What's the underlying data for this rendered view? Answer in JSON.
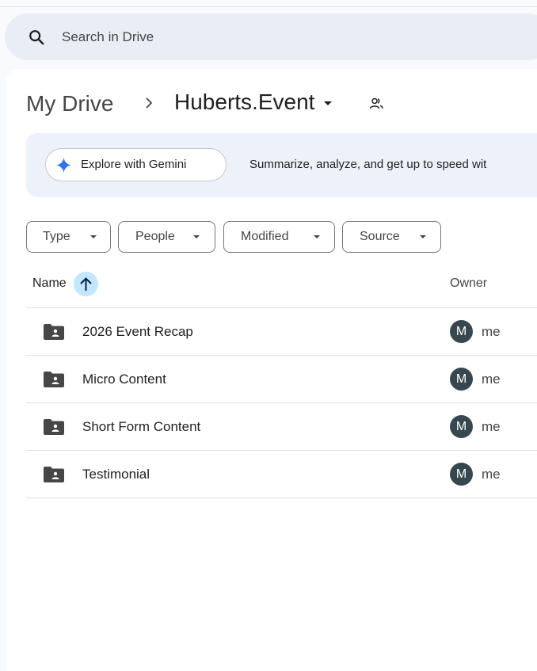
{
  "search": {
    "placeholder": "Search in Drive"
  },
  "breadcrumb": {
    "root": "My Drive",
    "separator": "›",
    "current": "Huberts.Event"
  },
  "gemini": {
    "button_label": "Explore with Gemini",
    "description": "Summarize, analyze, and get up to speed wit"
  },
  "filters": [
    {
      "label": "Type"
    },
    {
      "label": "People"
    },
    {
      "label": "Modified"
    },
    {
      "label": "Source"
    }
  ],
  "columns": {
    "name": "Name",
    "owner": "Owner"
  },
  "rows": [
    {
      "name": "2026 Event Recap",
      "owner_initial": "M",
      "owner": "me"
    },
    {
      "name": "Micro Content",
      "owner_initial": "M",
      "owner": "me"
    },
    {
      "name": "Short Form Content",
      "owner_initial": "M",
      "owner": "me"
    },
    {
      "name": "Testimonial",
      "owner_initial": "M",
      "owner": "me"
    }
  ],
  "colors": {
    "accent_sort": "#c2e7ff",
    "gemini_blue": "#4285f4",
    "avatar": "#37474f"
  },
  "icons": [
    "search-icon",
    "chevron-right-icon",
    "caret-down-icon",
    "shared-people-icon",
    "gemini-sparkle-icon",
    "arrow-up-icon",
    "shared-folder-icon"
  ]
}
